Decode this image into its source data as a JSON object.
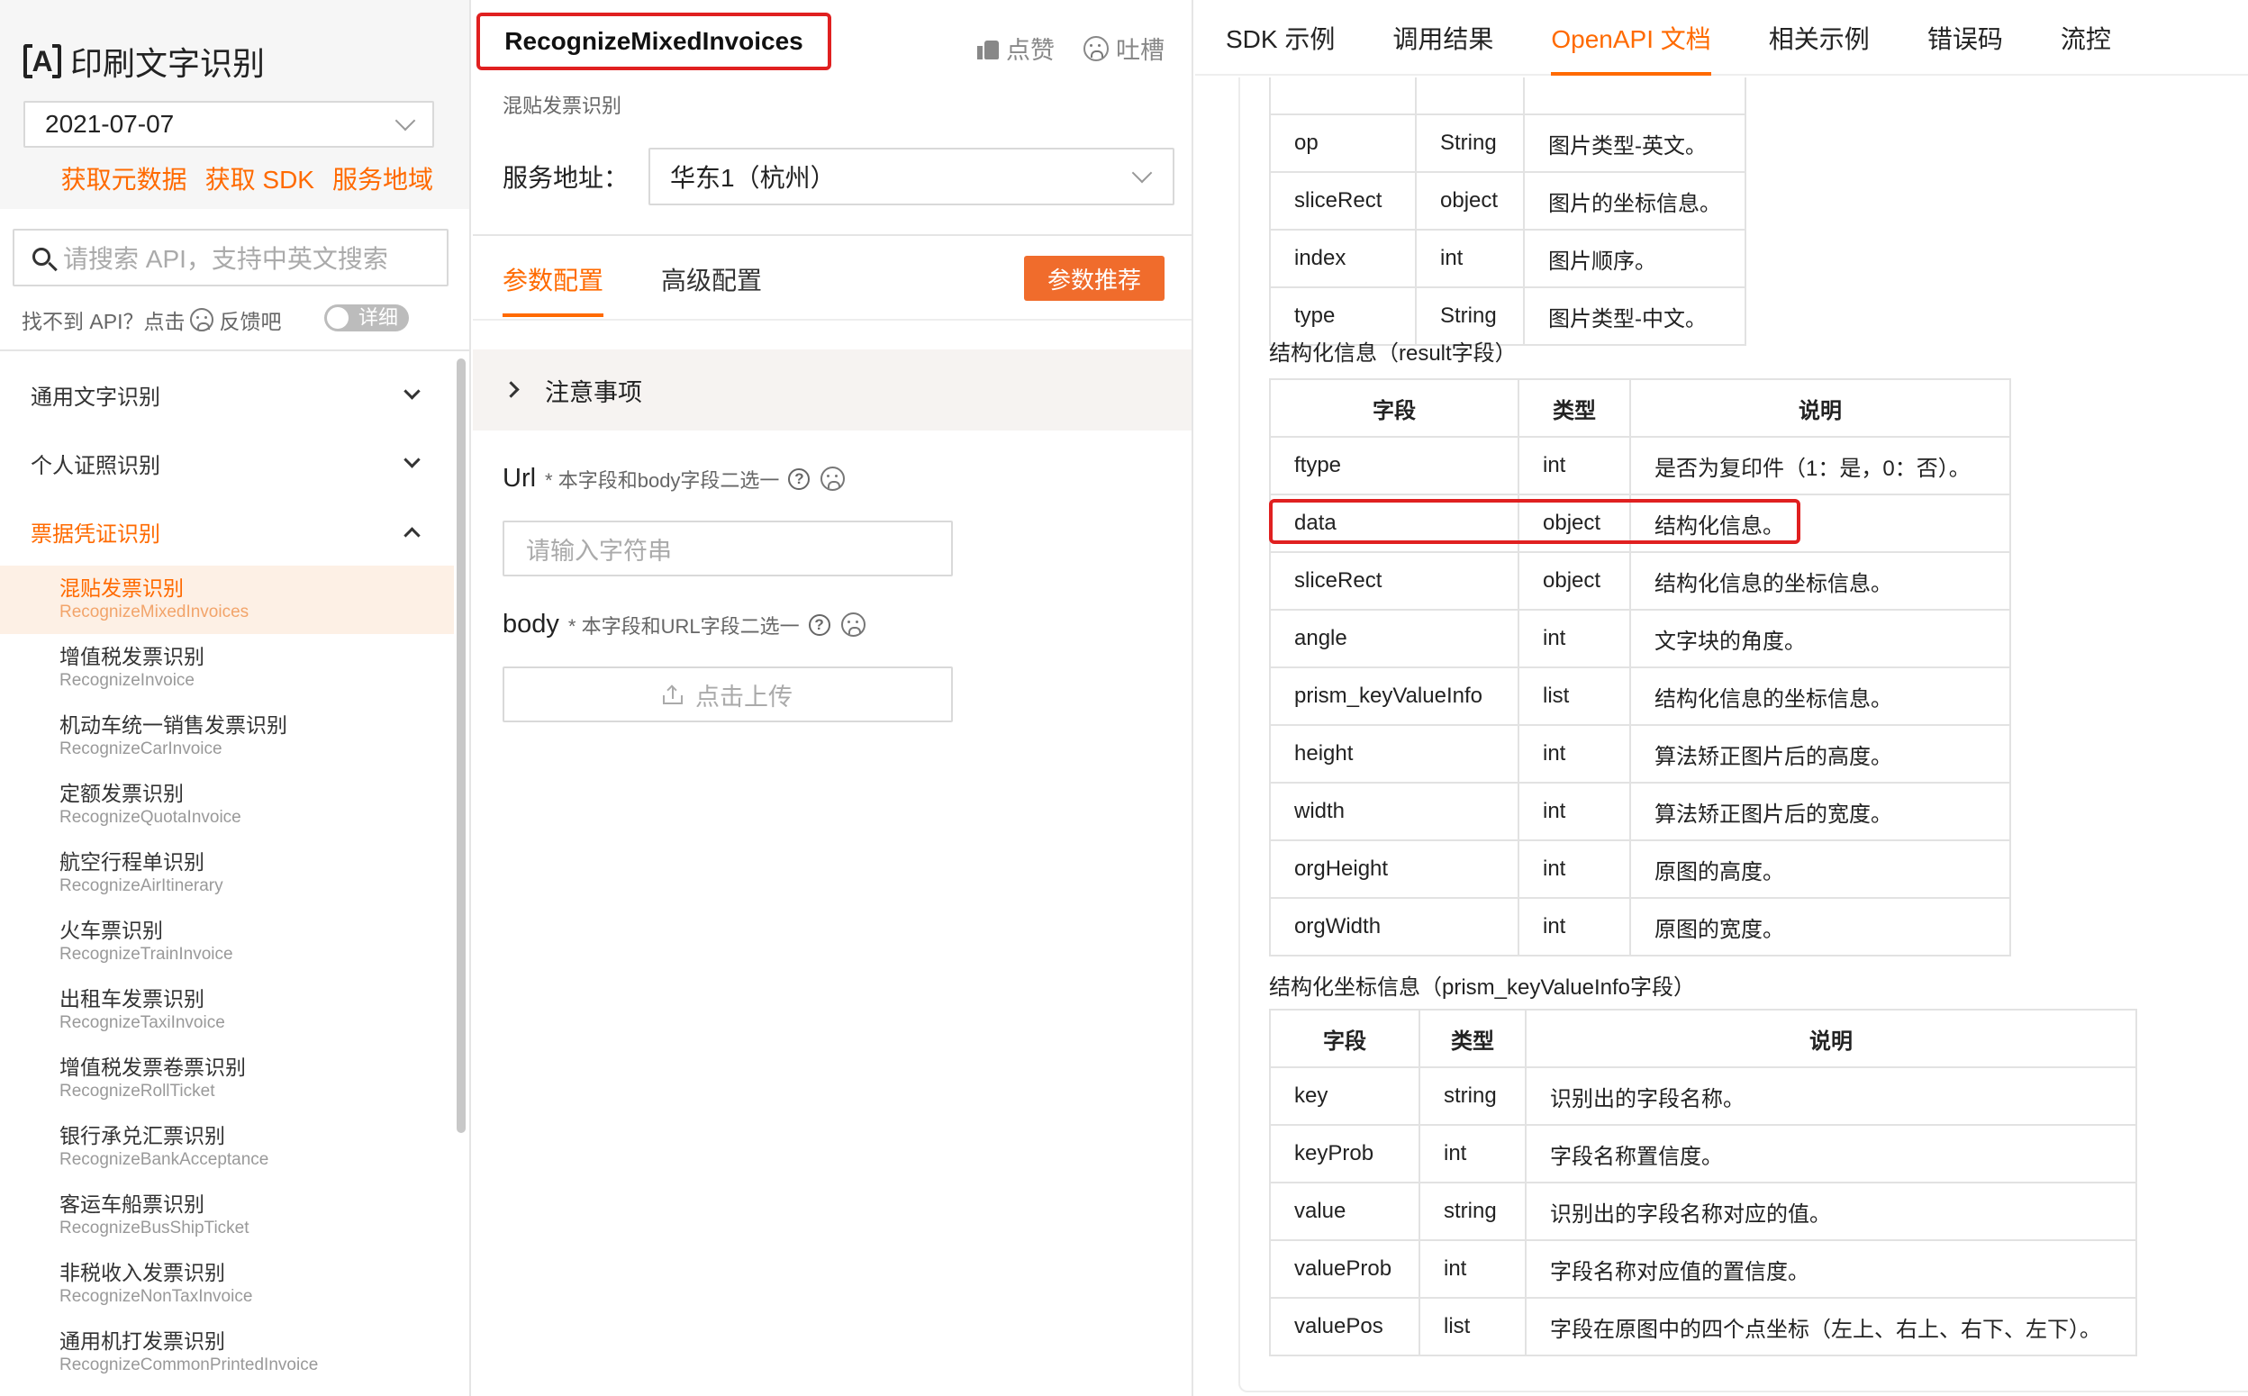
{
  "sidebar": {
    "app_title": "印刷文字识别",
    "logo_glyph": "A",
    "date": "2021-07-07",
    "links": [
      "获取元数据",
      "获取 SDK",
      "服务地域"
    ],
    "search_placeholder": "请搜索 API，支持中英文搜索",
    "feedback_prefix": "找不到 API？点击",
    "feedback_suffix": "反馈吧",
    "toggle_label": "详细",
    "groups": [
      {
        "label": "通用文字识别",
        "expanded": false
      },
      {
        "label": "个人证照识别",
        "expanded": false
      },
      {
        "label": "票据凭证识别",
        "expanded": true
      }
    ],
    "items": [
      {
        "cn": "混贴发票识别",
        "en": "RecognizeMixedInvoices",
        "active": true
      },
      {
        "cn": "增值税发票识别",
        "en": "RecognizeInvoice"
      },
      {
        "cn": "机动车统一销售发票识别",
        "en": "RecognizeCarInvoice"
      },
      {
        "cn": "定额发票识别",
        "en": "RecognizeQuotaInvoice"
      },
      {
        "cn": "航空行程单识别",
        "en": "RecognizeAirItinerary"
      },
      {
        "cn": "火车票识别",
        "en": "RecognizeTrainInvoice"
      },
      {
        "cn": "出租车发票识别",
        "en": "RecognizeTaxiInvoice"
      },
      {
        "cn": "增值税发票卷票识别",
        "en": "RecognizeRollTicket"
      },
      {
        "cn": "银行承兑汇票识别",
        "en": "RecognizeBankAcceptance"
      },
      {
        "cn": "客运车船票识别",
        "en": "RecognizeBusShipTicket"
      },
      {
        "cn": "非税收入发票识别",
        "en": "RecognizeNonTaxInvoice"
      },
      {
        "cn": "通用机打发票识别",
        "en": "RecognizeCommonPrintedInvoice"
      }
    ]
  },
  "middle": {
    "api_name": "RecognizeMixedInvoices",
    "api_subtitle": "混贴发票识别",
    "like_label": "点赞",
    "complain_label": "吐槽",
    "service_label": "服务地址：",
    "service_value": "华东1（杭州）",
    "tabs": [
      "参数配置",
      "高级配置"
    ],
    "recommend_button": "参数推荐",
    "notice_label": "注意事项",
    "url_label": "Url",
    "url_hint": "* 本字段和body字段二选一",
    "url_placeholder": "请输入字符串",
    "body_label": "body",
    "body_hint": "* 本字段和URL字段二选一",
    "upload_label": "点击上传",
    "help_glyph": "?"
  },
  "right": {
    "tabs": [
      "SDK 示例",
      "调用结果",
      "OpenAPI 文档",
      "相关示例",
      "错误码",
      "流控"
    ],
    "active_tab": 2,
    "table1_rows": [
      [
        "op",
        "String",
        "图片类型-英文。"
      ],
      [
        "sliceRect",
        "object",
        "图片的坐标信息。"
      ],
      [
        "index",
        "int",
        "图片顺序。"
      ],
      [
        "type",
        "String",
        "图片类型-中文。"
      ]
    ],
    "section2_title": "结构化信息（result字段）",
    "headers": [
      "字段",
      "类型",
      "说明"
    ],
    "table2_rows": [
      [
        "ftype",
        "int",
        "是否为复印件（1：是，0：否）。"
      ],
      [
        "data",
        "object",
        "结构化信息。"
      ],
      [
        "sliceRect",
        "object",
        "结构化信息的坐标信息。"
      ],
      [
        "angle",
        "int",
        "文字块的角度。"
      ],
      [
        "prism_keyValueInfo",
        "list",
        "结构化信息的坐标信息。"
      ],
      [
        "height",
        "int",
        "算法矫正图片后的高度。"
      ],
      [
        "width",
        "int",
        "算法矫正图片后的宽度。"
      ],
      [
        "orgHeight",
        "int",
        "原图的高度。"
      ],
      [
        "orgWidth",
        "int",
        "原图的宽度。"
      ]
    ],
    "section3_title": "结构化坐标信息（prism_keyValueInfo字段）",
    "table3_rows": [
      [
        "key",
        "string",
        "识别出的字段名称。"
      ],
      [
        "keyProb",
        "int",
        "字段名称置信度。"
      ],
      [
        "value",
        "string",
        "识别出的字段名称对应的值。"
      ],
      [
        "valueProb",
        "int",
        "字段名称对应值的置信度。"
      ],
      [
        "valuePos",
        "list",
        "字段在原图中的四个点坐标（左上、右上、右下、左下）。"
      ]
    ]
  },
  "colors": {
    "accent": "#ff6a00",
    "highlight": "#e02020"
  }
}
